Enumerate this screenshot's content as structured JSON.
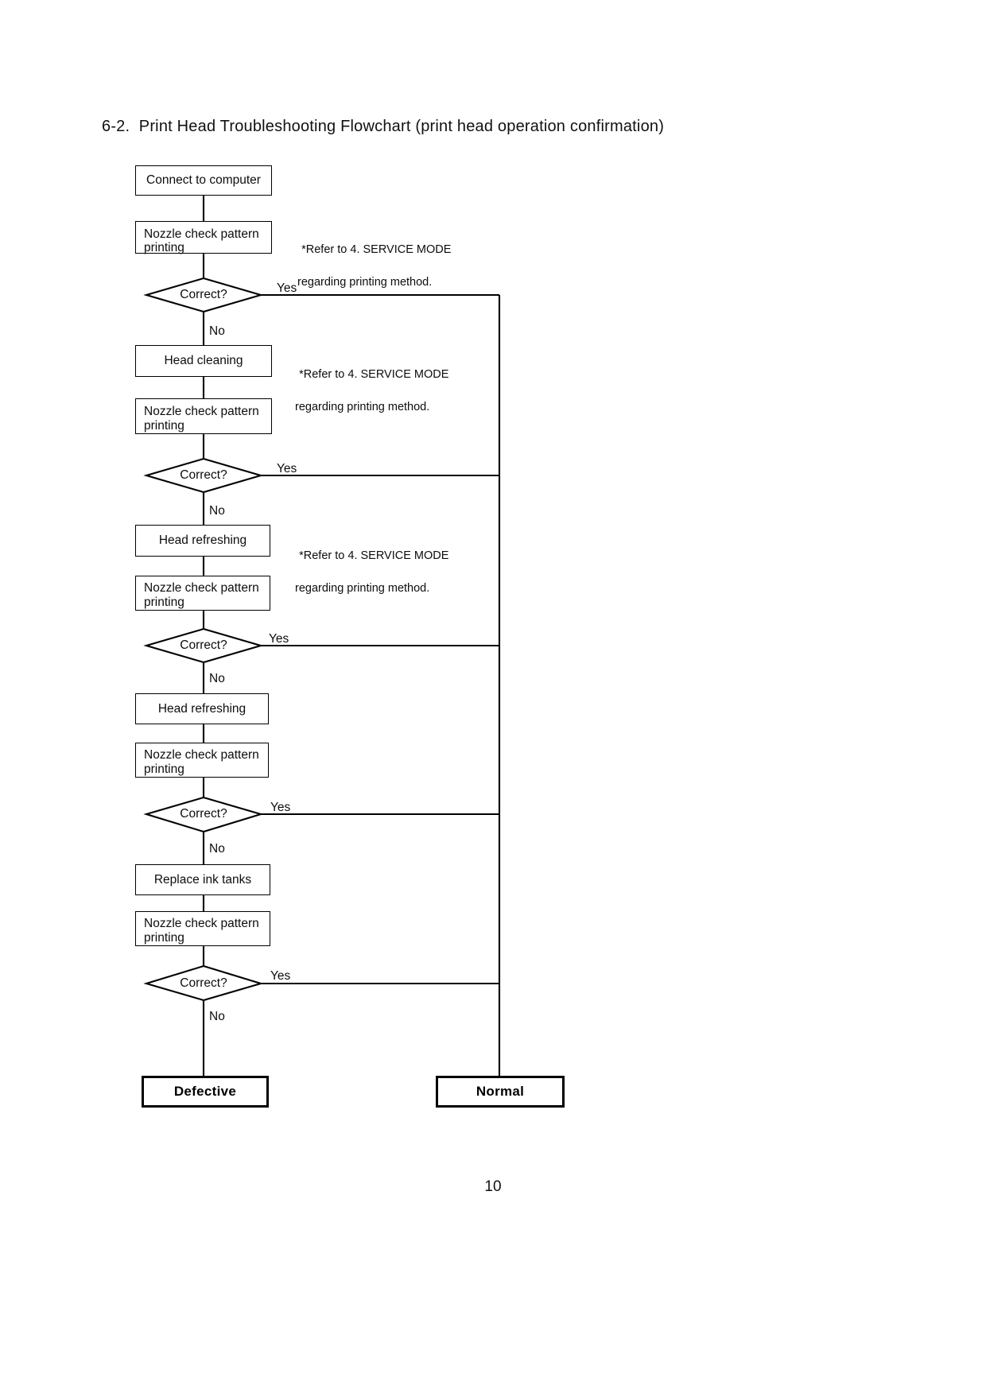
{
  "document": {
    "heading": "6-2.  Print Head Troubleshooting Flowchart (print head operation confirmation)",
    "page_number": "10"
  },
  "flowchart": {
    "type": "flowchart",
    "orientation": "top-to-bottom",
    "ink_color": "#000000",
    "background_color": "#ffffff",
    "nodes": [
      {
        "id": "n1",
        "shape": "process",
        "label": "Connect to computer"
      },
      {
        "id": "n2",
        "shape": "process",
        "label": "Nozzle check pattern printing"
      },
      {
        "id": "d1",
        "shape": "decision",
        "label": "Correct?"
      },
      {
        "id": "n3",
        "shape": "process",
        "label": "Head cleaning"
      },
      {
        "id": "n4",
        "shape": "process",
        "label": "Nozzle check pattern printing"
      },
      {
        "id": "d2",
        "shape": "decision",
        "label": "Correct?"
      },
      {
        "id": "n5",
        "shape": "process",
        "label": "Head refreshing"
      },
      {
        "id": "n6",
        "shape": "process",
        "label": "Nozzle check pattern printing"
      },
      {
        "id": "d3",
        "shape": "decision",
        "label": "Correct?"
      },
      {
        "id": "n7",
        "shape": "process",
        "label": "Head refreshing"
      },
      {
        "id": "n8",
        "shape": "process",
        "label": "Nozzle check pattern printing"
      },
      {
        "id": "d4",
        "shape": "decision",
        "label": "Correct?"
      },
      {
        "id": "n9",
        "shape": "process",
        "label": "Replace ink tanks"
      },
      {
        "id": "n10",
        "shape": "process",
        "label": "Nozzle check pattern printing"
      },
      {
        "id": "d5",
        "shape": "decision",
        "label": "Correct?"
      },
      {
        "id": "t1",
        "shape": "terminator",
        "label": "Defective"
      },
      {
        "id": "t2",
        "shape": "terminator",
        "label": "Normal"
      }
    ],
    "branch_labels": {
      "yes": "Yes",
      "no": "No"
    },
    "edges": [
      {
        "from": "n1",
        "to": "n2",
        "label": ""
      },
      {
        "from": "n2",
        "to": "d1",
        "label": ""
      },
      {
        "from": "d1",
        "to": "t2",
        "label": "Yes"
      },
      {
        "from": "d1",
        "to": "n3",
        "label": "No"
      },
      {
        "from": "n3",
        "to": "n4",
        "label": ""
      },
      {
        "from": "n4",
        "to": "d2",
        "label": ""
      },
      {
        "from": "d2",
        "to": "t2",
        "label": "Yes"
      },
      {
        "from": "d2",
        "to": "n5",
        "label": "No"
      },
      {
        "from": "n5",
        "to": "n6",
        "label": ""
      },
      {
        "from": "n6",
        "to": "d3",
        "label": ""
      },
      {
        "from": "d3",
        "to": "t2",
        "label": "Yes"
      },
      {
        "from": "d3",
        "to": "n7",
        "label": "No"
      },
      {
        "from": "n7",
        "to": "n8",
        "label": ""
      },
      {
        "from": "n8",
        "to": "d4",
        "label": ""
      },
      {
        "from": "d4",
        "to": "t2",
        "label": "Yes"
      },
      {
        "from": "d4",
        "to": "n9",
        "label": "No"
      },
      {
        "from": "n9",
        "to": "n10",
        "label": ""
      },
      {
        "from": "n10",
        "to": "d5",
        "label": ""
      },
      {
        "from": "d5",
        "to": "t2",
        "label": "Yes"
      },
      {
        "from": "d5",
        "to": "t1",
        "label": "No"
      }
    ],
    "notes": [
      {
        "id": "note1",
        "line1": "*Refer to 4. SERVICE MODE",
        "line2": "regarding printing method.",
        "attached_to": "n2"
      },
      {
        "id": "note2",
        "line1": "*Refer to 4. SERVICE MODE",
        "line2": "regarding printing method.",
        "attached_to": "n3"
      },
      {
        "id": "note3",
        "line1": "*Refer to 4. SERVICE MODE",
        "line2": "regarding printing method.",
        "attached_to": "n5"
      }
    ]
  },
  "boxes": {
    "b1_line1": "Connect to computer",
    "b2_line1": "Nozzle check pattern",
    "b2_line2": "printing",
    "b3_line1": "Head cleaning",
    "b4_line1": "Nozzle check pattern",
    "b4_line2": "printing",
    "b5_line1": "Head refreshing",
    "b6_line1": "Nozzle check pattern",
    "b6_line2": "printing",
    "b7_line1": "Head refreshing",
    "b8_line1": "Nozzle check pattern",
    "b8_line2": "printing",
    "b9_line1": "Replace ink tanks",
    "b10_line1": "Nozzle check pattern",
    "b10_line2": "printing",
    "defective": "Defective",
    "normal": "Normal"
  },
  "decisions": {
    "d1": "Correct?",
    "d2": "Correct?",
    "d3": "Correct?",
    "d4": "Correct?",
    "d5": "Correct?"
  },
  "branches": {
    "yes1": "Yes",
    "no1": "No",
    "yes2": "Yes",
    "no2": "No",
    "yes3": "Yes",
    "no3": "No",
    "yes4": "Yes",
    "no4": "No",
    "yes5": "Yes",
    "no5": "No"
  },
  "notes": {
    "n1_l1": "*Refer to 4. SERVICE MODE",
    "n1_l2": "regarding printing method.",
    "n2_l1": "*Refer to 4. SERVICE MODE",
    "n2_l2": "regarding printing method.",
    "n3_l1": "*Refer to 4. SERVICE MODE",
    "n3_l2": "regarding printing method."
  }
}
